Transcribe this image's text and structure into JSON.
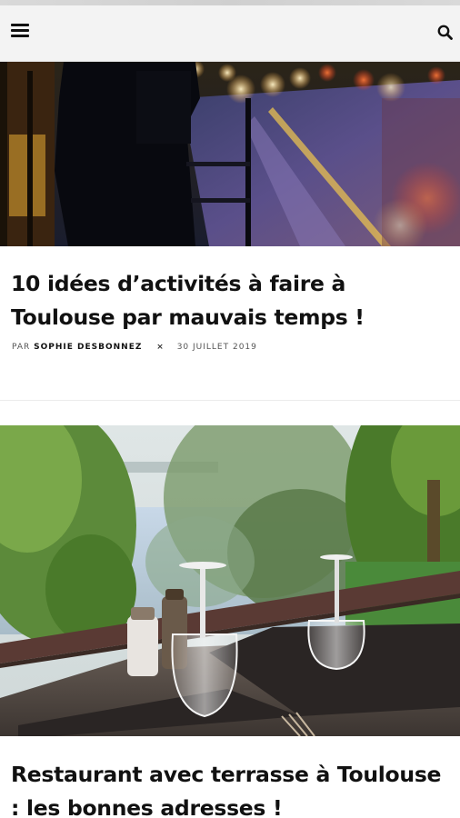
{
  "header": {
    "menu_icon": "hamburger-menu-icon",
    "search_icon": "search-icon",
    "background": "#f3f3f3"
  },
  "articles": [
    {
      "image_alt": "Silhouette d'une personne au bord d'une rue mouillée la nuit avec lumières floues",
      "title": "10 idées d’activités à faire à Toulouse par mauvais temps !",
      "meta_prefix": "PAR",
      "author": "SOPHIE DESBONNEZ",
      "separator": "×",
      "date": "30 JUILLET 2019"
    },
    {
      "image_alt": "Table de restaurant en terrasse avec verres retournés face à la rivière et aux arbres",
      "title": "Restaurant avec terrasse à Toulouse : les bonnes adresses !"
    }
  ]
}
